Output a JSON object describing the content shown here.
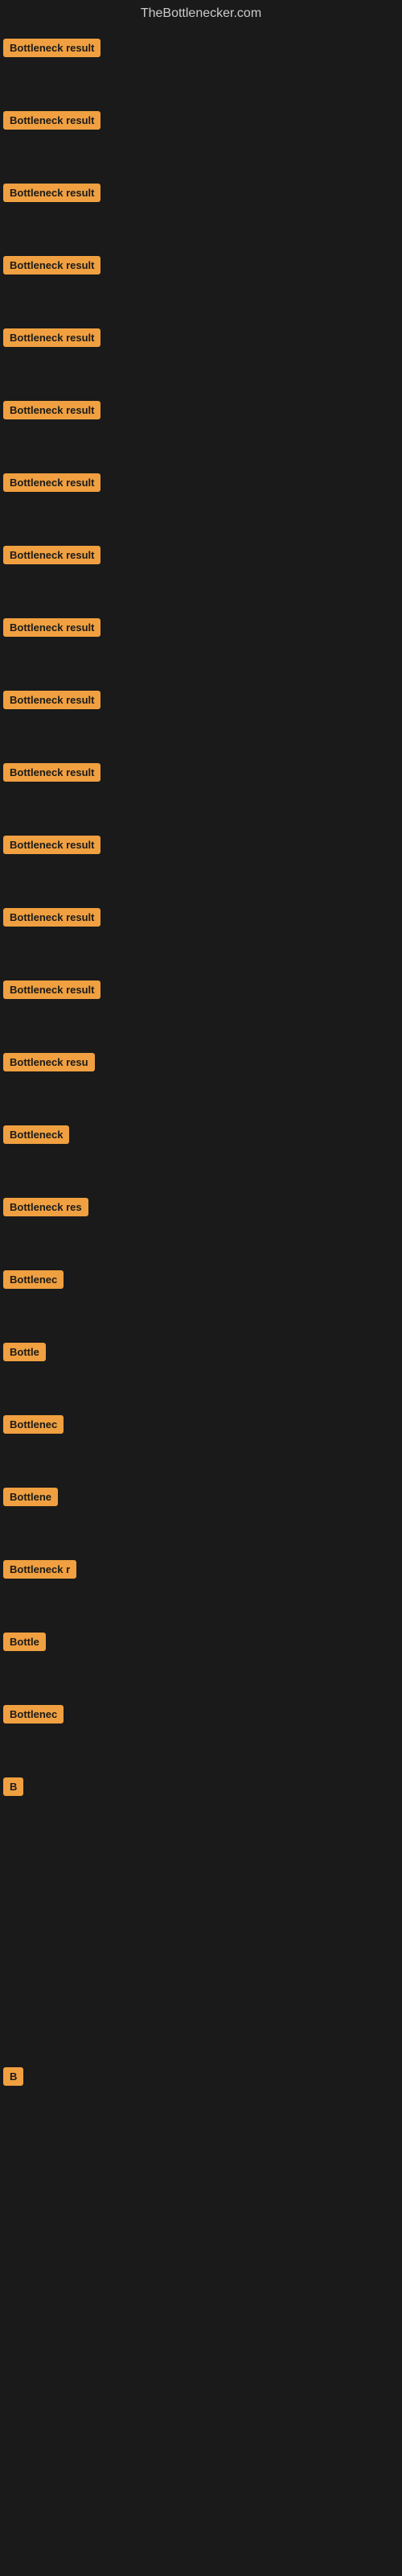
{
  "site": {
    "title": "TheBottlenecker.com"
  },
  "rows": [
    {
      "id": 1,
      "label": "Bottleneck result",
      "width": 130
    },
    {
      "id": 2,
      "label": "Bottleneck result",
      "width": 130
    },
    {
      "id": 3,
      "label": "Bottleneck result",
      "width": 130
    },
    {
      "id": 4,
      "label": "Bottleneck result",
      "width": 130
    },
    {
      "id": 5,
      "label": "Bottleneck result",
      "width": 130
    },
    {
      "id": 6,
      "label": "Bottleneck result",
      "width": 130
    },
    {
      "id": 7,
      "label": "Bottleneck result",
      "width": 130
    },
    {
      "id": 8,
      "label": "Bottleneck result",
      "width": 130
    },
    {
      "id": 9,
      "label": "Bottleneck result",
      "width": 130
    },
    {
      "id": 10,
      "label": "Bottleneck result",
      "width": 130
    },
    {
      "id": 11,
      "label": "Bottleneck result",
      "width": 130
    },
    {
      "id": 12,
      "label": "Bottleneck result",
      "width": 130
    },
    {
      "id": 13,
      "label": "Bottleneck result",
      "width": 130
    },
    {
      "id": 14,
      "label": "Bottleneck result",
      "width": 130
    },
    {
      "id": 15,
      "label": "Bottleneck resu",
      "width": 115
    },
    {
      "id": 16,
      "label": "Bottleneck",
      "width": 85
    },
    {
      "id": 17,
      "label": "Bottleneck res",
      "width": 105
    },
    {
      "id": 18,
      "label": "Bottlenec",
      "width": 75
    },
    {
      "id": 19,
      "label": "Bottle",
      "width": 58
    },
    {
      "id": 20,
      "label": "Bottlenec",
      "width": 75
    },
    {
      "id": 21,
      "label": "Bottlene",
      "width": 68
    },
    {
      "id": 22,
      "label": "Bottleneck r",
      "width": 92
    },
    {
      "id": 23,
      "label": "Bottle",
      "width": 58
    },
    {
      "id": 24,
      "label": "Bottlenec",
      "width": 75
    },
    {
      "id": 25,
      "label": "B",
      "width": 18
    },
    {
      "id": 26,
      "label": "",
      "width": 0
    },
    {
      "id": 27,
      "label": "",
      "width": 0
    },
    {
      "id": 28,
      "label": "",
      "width": 0
    },
    {
      "id": 29,
      "label": "B",
      "width": 18
    },
    {
      "id": 30,
      "label": "",
      "width": 0
    },
    {
      "id": 31,
      "label": "",
      "width": 0
    },
    {
      "id": 32,
      "label": "",
      "width": 0
    },
    {
      "id": 33,
      "label": "",
      "width": 0
    },
    {
      "id": 34,
      "label": "",
      "width": 0
    }
  ]
}
